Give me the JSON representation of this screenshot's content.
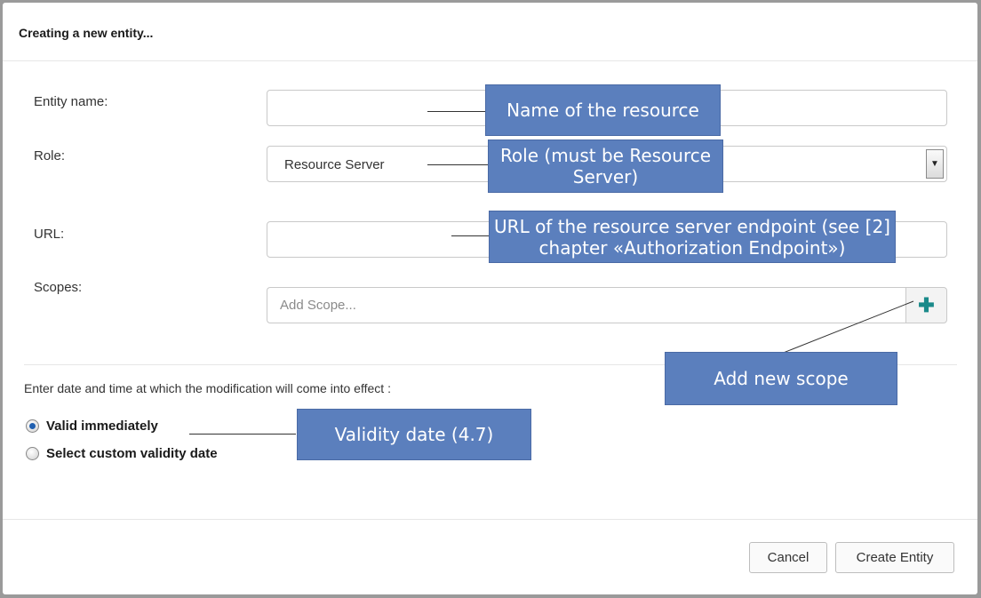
{
  "dialog": {
    "title": "Creating a new entity..."
  },
  "form": {
    "entity_name_label": "Entity name:",
    "entity_name_value": "",
    "role_label": "Role:",
    "role_value": "Resource Server",
    "url_label": "URL:",
    "url_value": "",
    "scopes_label": "Scopes:",
    "scope_placeholder": "Add Scope...",
    "add_scope_icon": "plus-icon"
  },
  "validity": {
    "prompt": "Enter date and time at which the modification will come into effect :",
    "options": [
      {
        "label": "Valid immediately",
        "checked": true
      },
      {
        "label": "Select custom validity date",
        "checked": false
      }
    ]
  },
  "buttons": {
    "cancel": "Cancel",
    "create": "Create Entity"
  },
  "callouts": {
    "name": "Name of the resource",
    "role": "Role (must be Resource Server)",
    "url": "URL of the resource server endpoint (see [2] chapter «Authorization Endpoint»)",
    "add_scope": "Add new scope",
    "validity": "Validity date (4.7)"
  },
  "colors": {
    "callout_bg": "#5b7fbd",
    "add_icon": "#1a8a8a",
    "radio_selected": "#1f5fb0"
  }
}
